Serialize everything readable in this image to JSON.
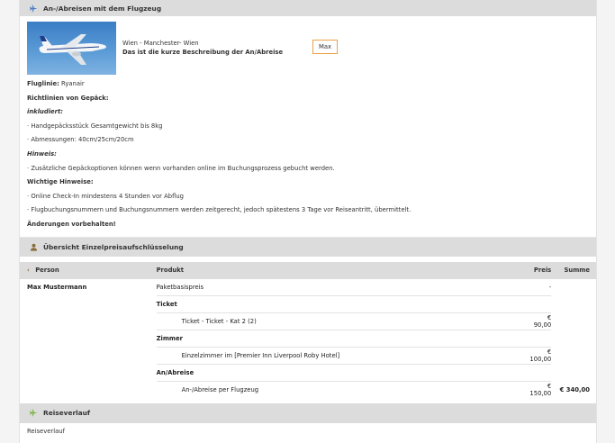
{
  "flight_section": {
    "title": "An-/Abreisen mit dem Flugzeug",
    "icon": "plane-icon",
    "route": "Wien - Manchester- Wien",
    "description": "Das ist die kurze Beschreibung der An/Abreise",
    "max_button": "Max",
    "airline_label": "Fluglinie:",
    "airline_value": "Ryanair",
    "lines": [
      "Richtlinien von Gepäck:",
      "inkludiert:",
      "· Handgepäcksstück Gesamtgewicht bis 8kg",
      "· Abmessungen: 40cm/25cm/20cm",
      "Hinweis:",
      "· Zusätzliche Gepäckoptionen können wenn vorhanden online im Buchungsprozess gebucht werden.",
      "Wichtige Hinweise:",
      "· Online Check-In mindestens 4 Stunden vor Abflug",
      "· Flugbuchungsnummern und Buchungsnummern werden zeitgerecht, jedoch spätestens 3 Tage vor Reiseantritt, übermittelt.",
      "Änderungen vorbehalten!"
    ]
  },
  "price_section": {
    "title": "Übersicht Einzelpreisaufschlüsselung",
    "icon": "person-icon",
    "headers": {
      "person": "Person",
      "product": "Produkt",
      "price": "Preis",
      "sum": "Summe"
    },
    "person_name": "Max Mustermann",
    "base_product": "Paketbasispreis",
    "base_price": "-",
    "groups": [
      {
        "name": "Ticket",
        "item": "Ticket - Ticket - Kat 2 (2)",
        "price": "€ 90,00"
      },
      {
        "name": "Zimmer",
        "item": "Einzelzimmer im [Premier Inn Liverpool Roby Hotel]",
        "price": "€ 100,00"
      },
      {
        "name": "An/Abreise",
        "item": "An-/Abreise per Flugzeug",
        "price": "€ 150,00"
      }
    ],
    "total": "€ 340,00"
  },
  "trip_section": {
    "title": "Reiseverlauf",
    "icon": "plane-icon",
    "text": "Reiseverlauf"
  },
  "colors": {
    "header_bar": "#dcdcdc",
    "accent_orange": "#e8a24a",
    "plane_green": "#7cb342",
    "plane_blue": "#4a7fc1"
  }
}
